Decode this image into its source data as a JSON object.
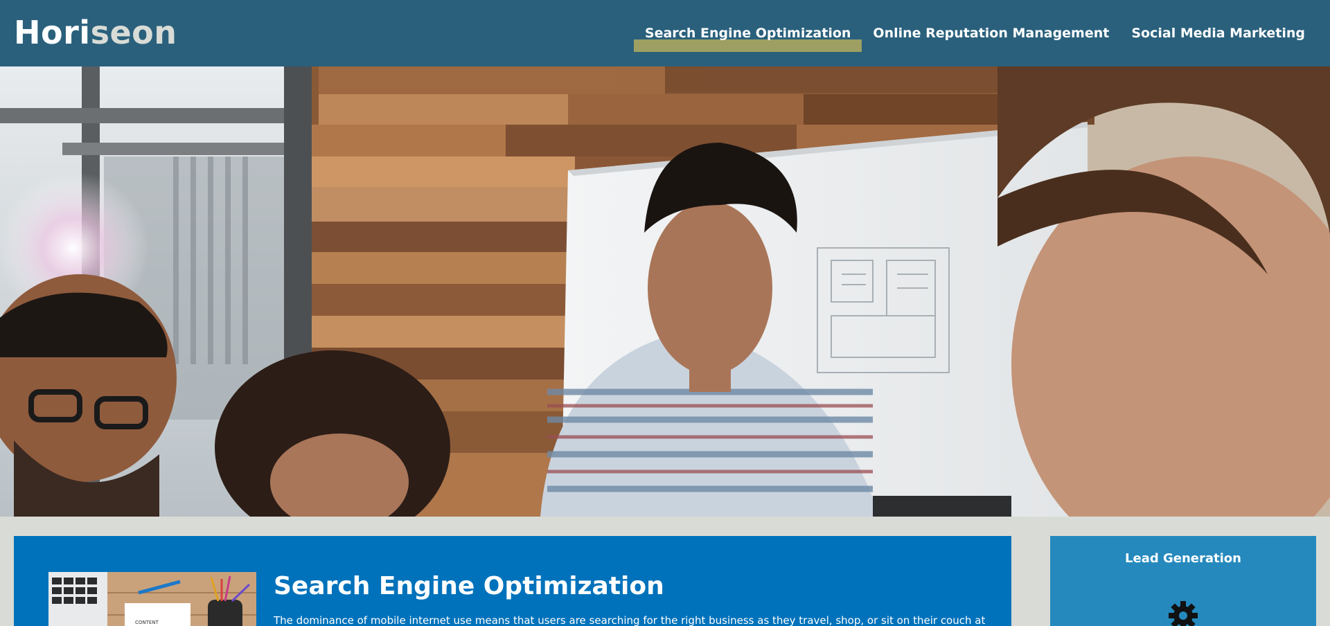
{
  "header": {
    "logo_part1": "Hori",
    "logo_part2": "seon",
    "nav": [
      {
        "label": "Search Engine Optimization",
        "active": true
      },
      {
        "label": "Online Reputation Management",
        "active": false
      },
      {
        "label": "Social Media Marketing",
        "active": false
      }
    ]
  },
  "main": {
    "section_title": "Search Engine Optimization",
    "section_text": "The dominance of mobile internet use means that users are searching for the right business as they travel, shop, or sit on their couch at"
  },
  "sidebar": {
    "title": "Lead Generation",
    "icon": "gear-icon"
  },
  "colors": {
    "header_bg": "#2a607c",
    "nav_active_highlight": "#a7a65f",
    "content_bg": "#0072bb",
    "sidebar_bg": "#2589bd",
    "page_bg": "#d9dcd6"
  }
}
